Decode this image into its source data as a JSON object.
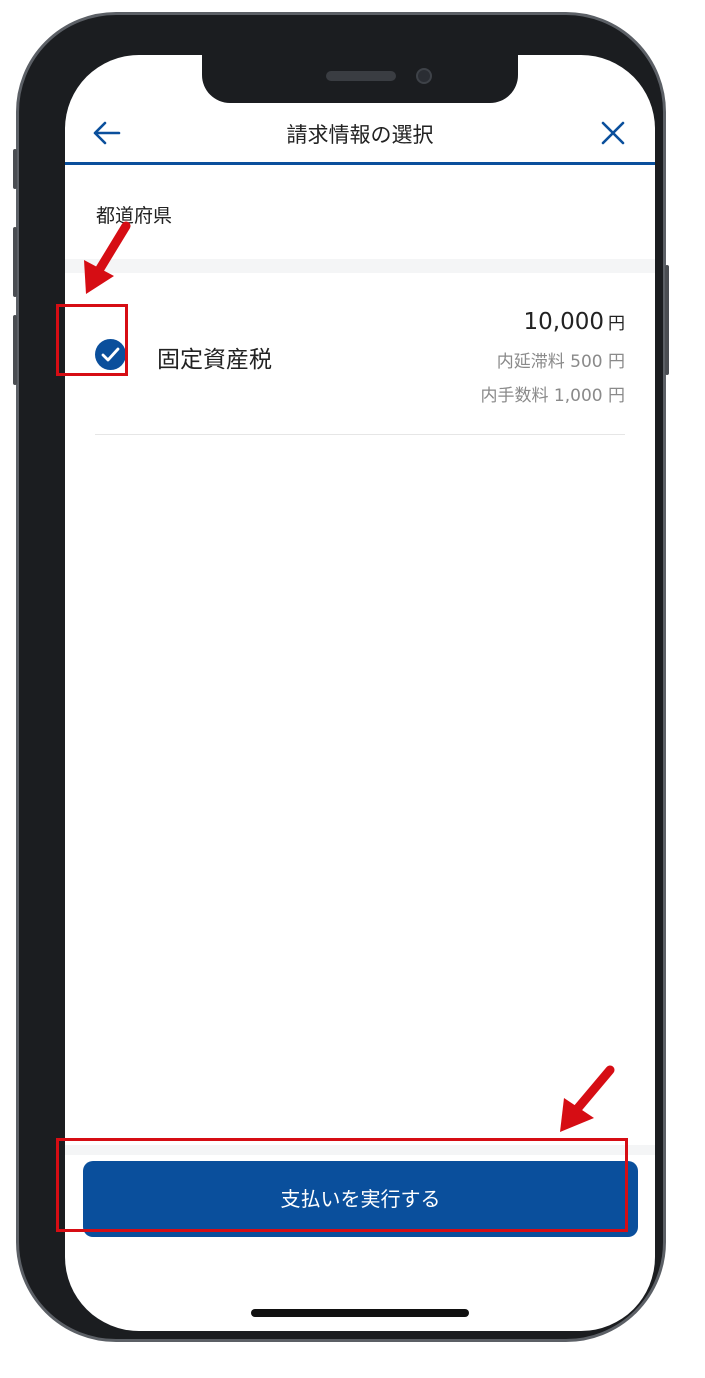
{
  "navbar": {
    "title": "請求情報の選択",
    "back_icon": "arrow-left-icon",
    "close_icon": "close-x-icon"
  },
  "section_label": "都道府県",
  "billing_item": {
    "selected": true,
    "name": "固定資産税",
    "amount": "10,000",
    "amount_unit": "円",
    "late_fee": "内延滞料 500 円",
    "fee": "内手数料 1,000 円"
  },
  "pay_button": {
    "label": "支払いを実行する"
  },
  "colors": {
    "primary": "#0a4f9c",
    "highlight": "#d60d14",
    "muted_text": "#8a8a8a"
  }
}
